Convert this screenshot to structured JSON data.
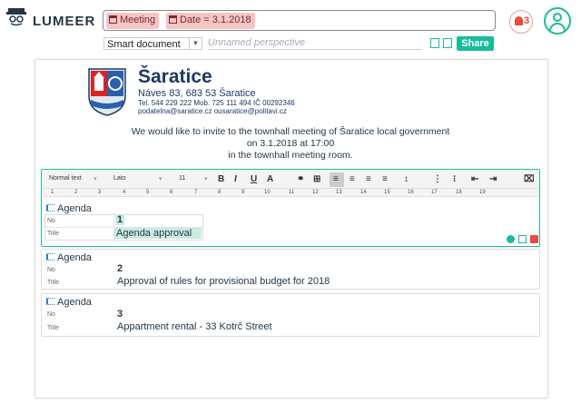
{
  "app": {
    "brand": "LUMEER"
  },
  "search": {
    "chips": [
      "Meeting",
      "Date = 3.1.2018"
    ]
  },
  "notifications": {
    "count": "3"
  },
  "view": {
    "type": "Smart document",
    "perspective_placeholder": "Unnamed perspective",
    "share_label": "Share"
  },
  "letterhead": {
    "town": "Šaratice",
    "address": "Náves 83, 683 53 Šaratice",
    "contact": "Tel. 544 229 222  Mob. 725 111 494  IČ 00292346",
    "emails": "podatelna@saratice.cz ousaratice@politavi.cz"
  },
  "invitation": [
    "We would like to invite to the townhall meeting of Šaratice local government",
    "on 3.1.2018 at 17:00",
    "in the townhall meeting room."
  ],
  "toolbar": {
    "style": "Normal text",
    "font": "Lato",
    "size": "11"
  },
  "ruler": [
    "1",
    "2",
    "3",
    "4",
    "5",
    "6",
    "7",
    "8",
    "9",
    "10",
    "11",
    "12",
    "13",
    "14",
    "15",
    "16",
    "17",
    "18",
    "19"
  ],
  "records": [
    {
      "heading": "Agenda",
      "no_label": "No",
      "title_label": "Title",
      "no": "1",
      "title": "Agenda approval"
    },
    {
      "heading": "Agenda",
      "no_label": "No",
      "title_label": "Title",
      "no": "2",
      "title": "Approval of rules for provisional budget for 2018"
    },
    {
      "heading": "Agenda",
      "no_label": "No",
      "title_label": "Title",
      "no": "3",
      "title": "Appartment rental - 33 Kotrč Street"
    }
  ],
  "colors": {
    "accent": "#18bc9c",
    "chip": "#f5c6c6",
    "alert": "#e74c3c",
    "crest_blue": "#1b3a63"
  }
}
